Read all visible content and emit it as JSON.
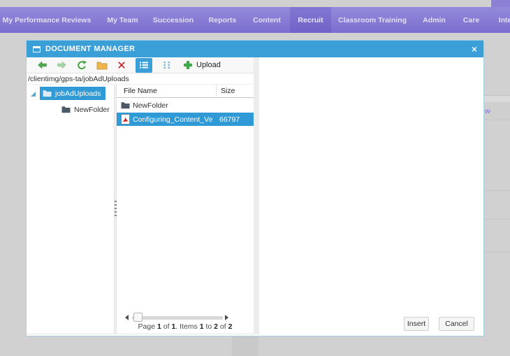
{
  "nav": {
    "items": [
      {
        "label": "My Performance Reviews",
        "active": false
      },
      {
        "label": "My Team",
        "active": false
      },
      {
        "label": "Succession",
        "active": false
      },
      {
        "label": "Reports",
        "active": false
      },
      {
        "label": "Content",
        "active": false
      },
      {
        "label": "Recruit",
        "active": true
      },
      {
        "label": "Classroom Training",
        "active": false
      },
      {
        "label": "Admin",
        "active": false
      },
      {
        "label": "Care",
        "active": false
      },
      {
        "label": "Inte",
        "active": false
      }
    ]
  },
  "background": {
    "partial_link": "w"
  },
  "dialog": {
    "title": "DOCUMENT MANAGER",
    "close_glyph": "×",
    "toolbar": {
      "upload_label": "Upload",
      "icons": [
        "back-icon",
        "forward-icon",
        "refresh-icon",
        "new-folder-icon",
        "delete-icon",
        "list-view-icon",
        "grid-view-icon",
        "plus-icon"
      ]
    },
    "address": "/clientimg/gps-ta/jobAdUploads",
    "tree": [
      {
        "label": "jobAdUploads",
        "selected": true
      },
      {
        "label": "NewFolder",
        "selected": false
      }
    ],
    "grid": {
      "columns": [
        "File Name",
        "Size"
      ],
      "rows": [
        {
          "name": "NewFolder",
          "size": "",
          "type": "folder",
          "selected": false
        },
        {
          "name": "Configuring_Content_Vendo",
          "size": "66797",
          "type": "pdf",
          "selected": true
        }
      ]
    },
    "pager": {
      "t0": "Page ",
      "n0": "1",
      "t1": " of ",
      "n1": "1",
      "t2": ". Items ",
      "n2": "1",
      "t3": " to ",
      "n3": "2",
      "t4": " of ",
      "n4": "2"
    },
    "buttons": {
      "insert": "Insert",
      "cancel": "Cancel"
    }
  },
  "colors": {
    "titlebar_blue": "#399fd6",
    "selection_blue": "#2f9ad5",
    "nav_purple_top": "#928ada",
    "nav_purple_bottom": "#7b6ecf",
    "nav_active_purple": "#7062c7",
    "overlay_gray": "#d1d1d1",
    "toolbar_green": "#4fa74f",
    "delete_red": "#c4252e",
    "folder_amber": "#eeb54c",
    "folder_slate": "#4d5966",
    "pdf_red": "#cf1d25"
  }
}
